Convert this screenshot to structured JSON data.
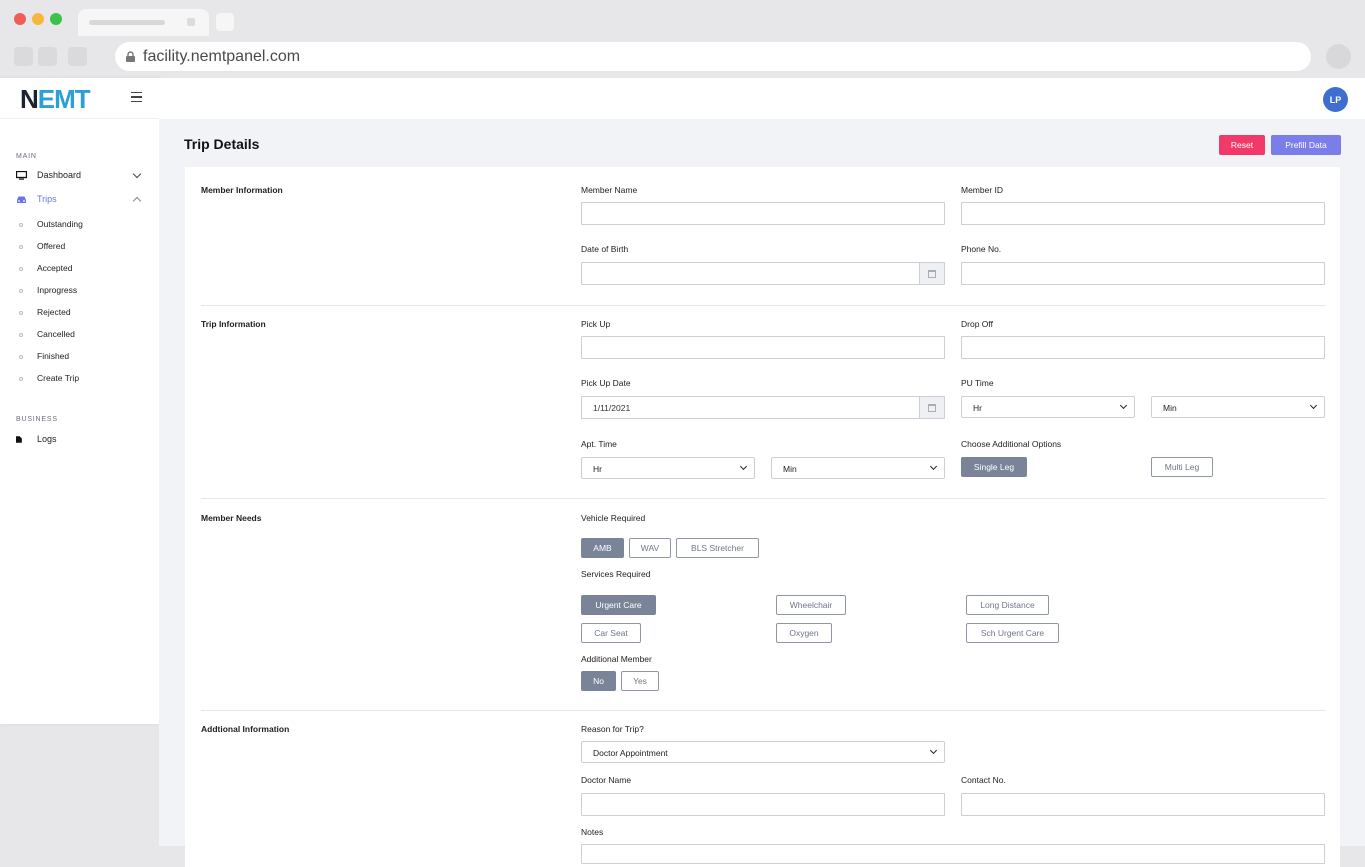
{
  "browser": {
    "url": "facility.nemtpanel.com",
    "traffic_colors": [
      "#f05d56",
      "#f6b83c",
      "#3dc249"
    ]
  },
  "sidebar": {
    "logo": {
      "n": "N",
      "emt": "EMT"
    },
    "sections": {
      "main": "MAIN",
      "business": "BUSINESS"
    },
    "dashboard": "Dashboard",
    "trips": "Trips",
    "trip_items": [
      "Outstanding",
      "Offered",
      "Accepted",
      "Inprogress",
      "Rejected",
      "Cancelled",
      "Finished",
      "Create Trip"
    ],
    "logs": "Logs"
  },
  "header": {
    "avatar_initials": "LP"
  },
  "page": {
    "title": "Trip Details",
    "reset_label": "Reset",
    "prefill_label": "Prefill Data"
  },
  "member_info": {
    "section": "Member Information",
    "member_name": "Member Name",
    "member_id": "Member ID",
    "dob": "Date of Birth",
    "phone": "Phone No."
  },
  "trip_info": {
    "section": "Trip Information",
    "pick_up": "Pick Up",
    "drop_off": "Drop Off",
    "pick_up_date": "Pick Up Date",
    "pick_up_date_value": "1/11/2021",
    "pu_time": "PU Time",
    "hr": "Hr",
    "min": "Min",
    "apt_time": "Apt. Time",
    "additional_options": "Choose Additional Options",
    "single_leg": "Single Leg",
    "multi_leg": "Multi Leg"
  },
  "member_needs": {
    "section": "Member Needs",
    "vehicle_required": "Vehicle Required",
    "vehicles": [
      "AMB",
      "WAV",
      "BLS Stretcher"
    ],
    "services_required": "Services Required",
    "services": [
      "Urgent Care",
      "Wheelchair",
      "Long Distance",
      "Car Seat",
      "Oxygen",
      "Sch Urgent Care"
    ],
    "additional_member": "Additional Member",
    "no": "No",
    "yes": "Yes"
  },
  "additional_info": {
    "section": "Addtional Information",
    "reason": "Reason for Trip?",
    "reason_value": "Doctor Appointment",
    "doctor_name": "Doctor Name",
    "contact_no": "Contact No.",
    "notes": "Notes"
  }
}
